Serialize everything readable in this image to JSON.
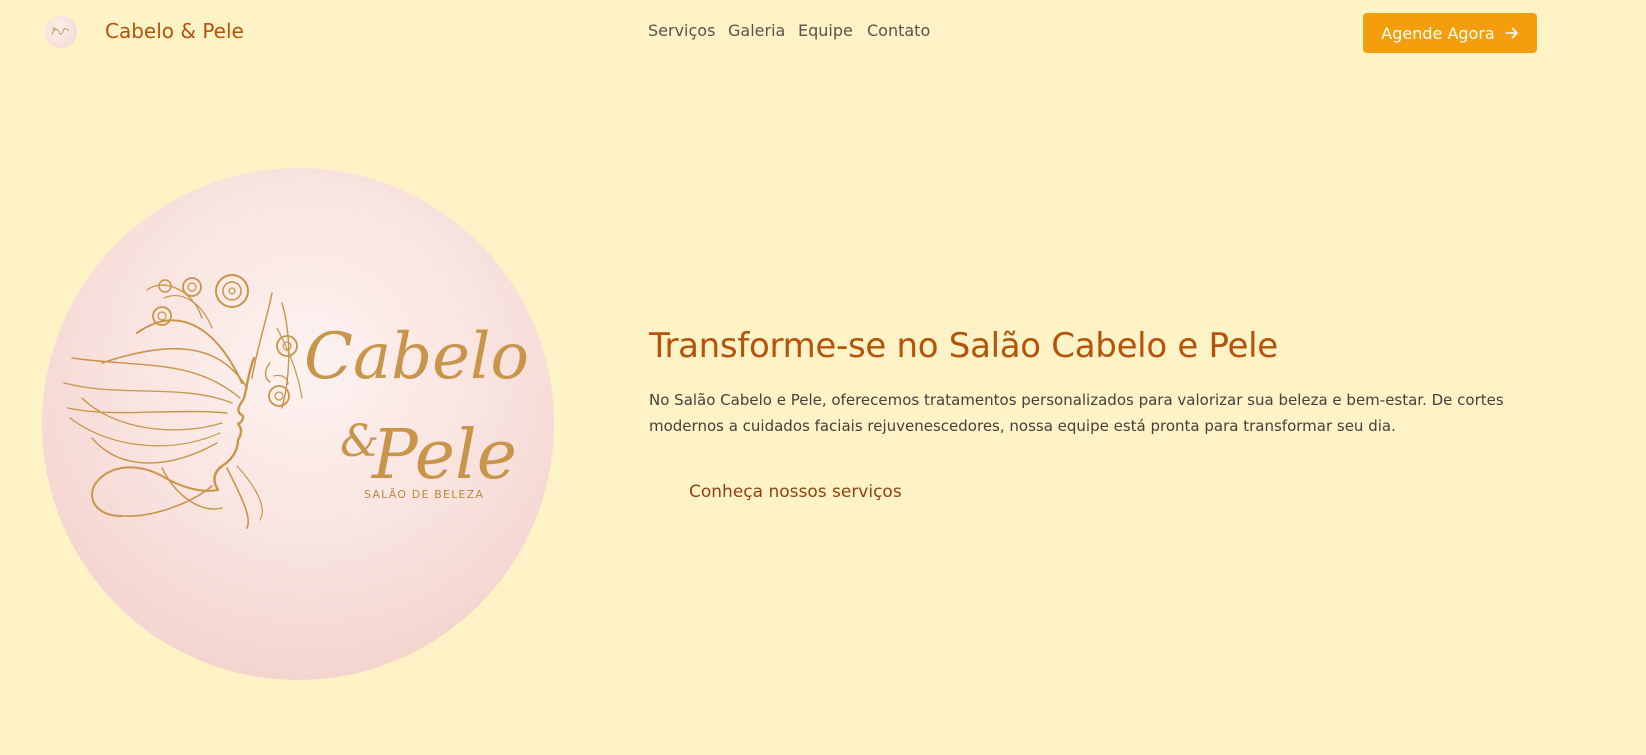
{
  "header": {
    "brand": "Cabelo & Pele",
    "nav": [
      {
        "label": "Serviços"
      },
      {
        "label": "Galeria"
      },
      {
        "label": "Equipe"
      },
      {
        "label": "Contato"
      }
    ],
    "cta_label": "Agende Agora",
    "cta_icon": "arrow-right-icon"
  },
  "hero": {
    "logo": {
      "wordmark_line1": "Cabelo",
      "wordmark_amp": "&",
      "wordmark_line2": "Pele",
      "tagline": "SALÃO DE BELEZA"
    },
    "headline": "Transforme-se no Salão Cabelo e Pele",
    "description": "No Salão Cabelo e Pele, oferecemos tratamentos personalizados para valorizar sua beleza e bem-estar. De cortes modernos a cuidados faciais rejuvenescedores, nossa equipe está pronta para transformar seu dia.",
    "services_link": "Conheça nossos serviços"
  },
  "colors": {
    "background": "#fef3c7",
    "brand": "#b45309",
    "accent": "#f59e0b",
    "logo_gold": "#c8954a",
    "logo_pink": "#f9e3df"
  }
}
